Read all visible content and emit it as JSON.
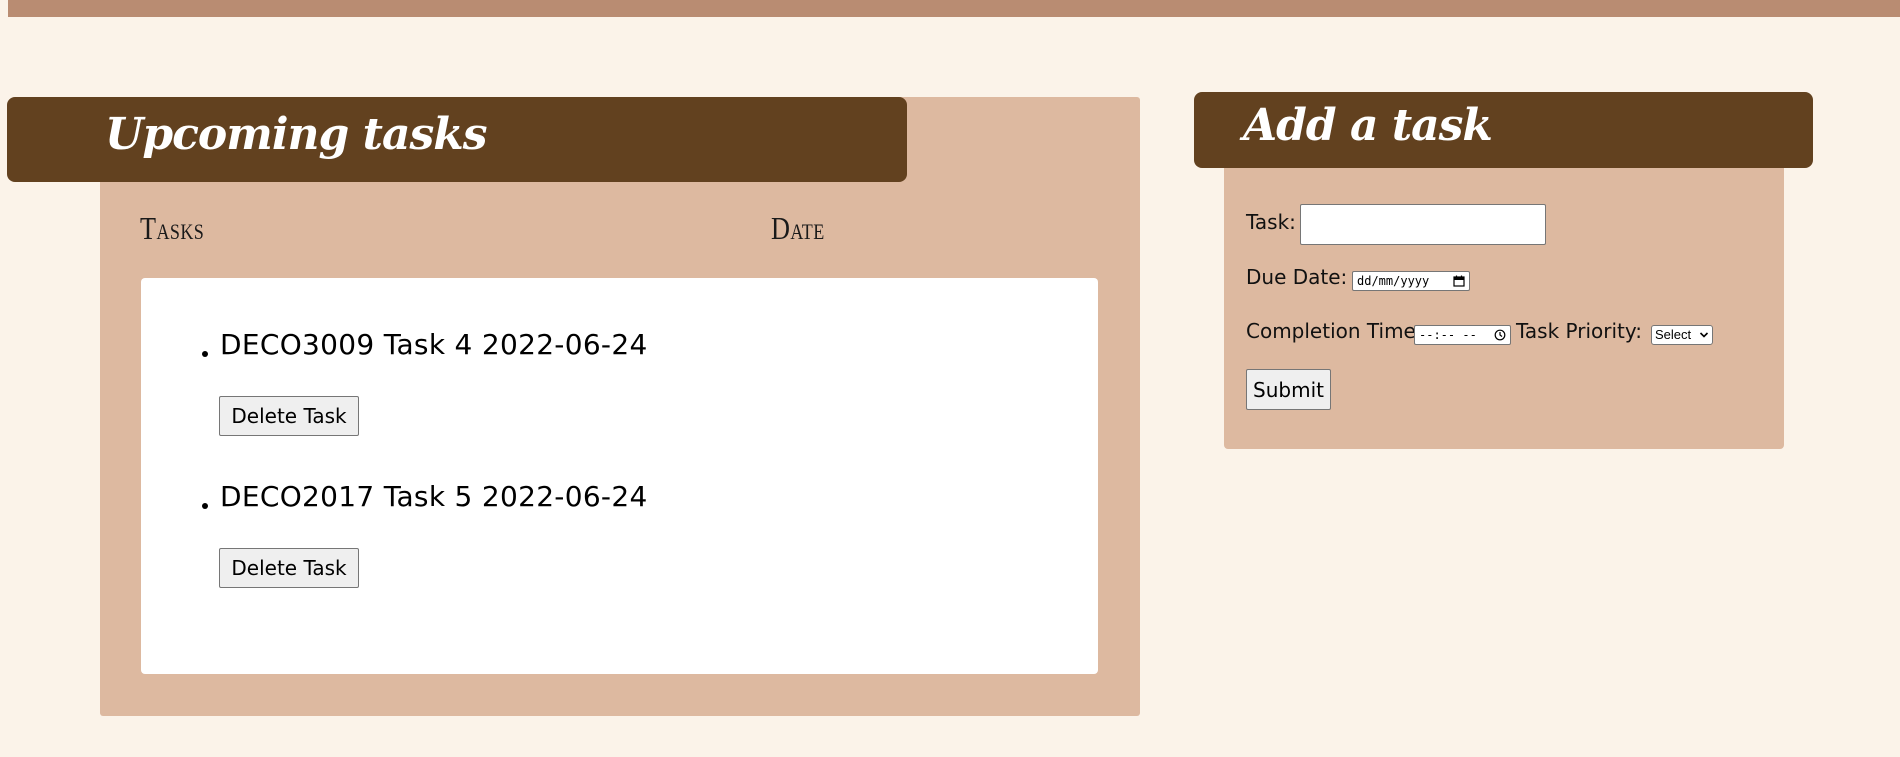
{
  "upcoming": {
    "title": "Upcoming tasks",
    "columns": [
      "Tasks",
      "Date"
    ],
    "tasks": [
      {
        "text": "DECO3009 Task 4 2022-06-24",
        "delete_label": "Delete Task"
      },
      {
        "text": "DECO2017 Task 5 2022-06-24",
        "delete_label": "Delete Task"
      }
    ]
  },
  "add_task": {
    "title": "Add a task",
    "task_label": "Task:",
    "task_value": "",
    "due_date_label": "Due Date:",
    "due_date_placeholder": "dd/mm/yyyy",
    "completion_time_label": "Completion Time:",
    "completion_time_placeholder": "--:-- --",
    "priority_label": "Task Priority:",
    "priority_selected": "Select",
    "submit_label": "Submit"
  },
  "icons": {
    "due_date": "calendar-icon",
    "completion_time": "clock-icon",
    "priority": "chevron-down-icon"
  },
  "colors": {
    "page_background": "#fbf3e9",
    "top_bar": "#b98c72",
    "card_background": "#ddb9a0",
    "header_background": "#62411f",
    "list_background": "#ffffff"
  }
}
